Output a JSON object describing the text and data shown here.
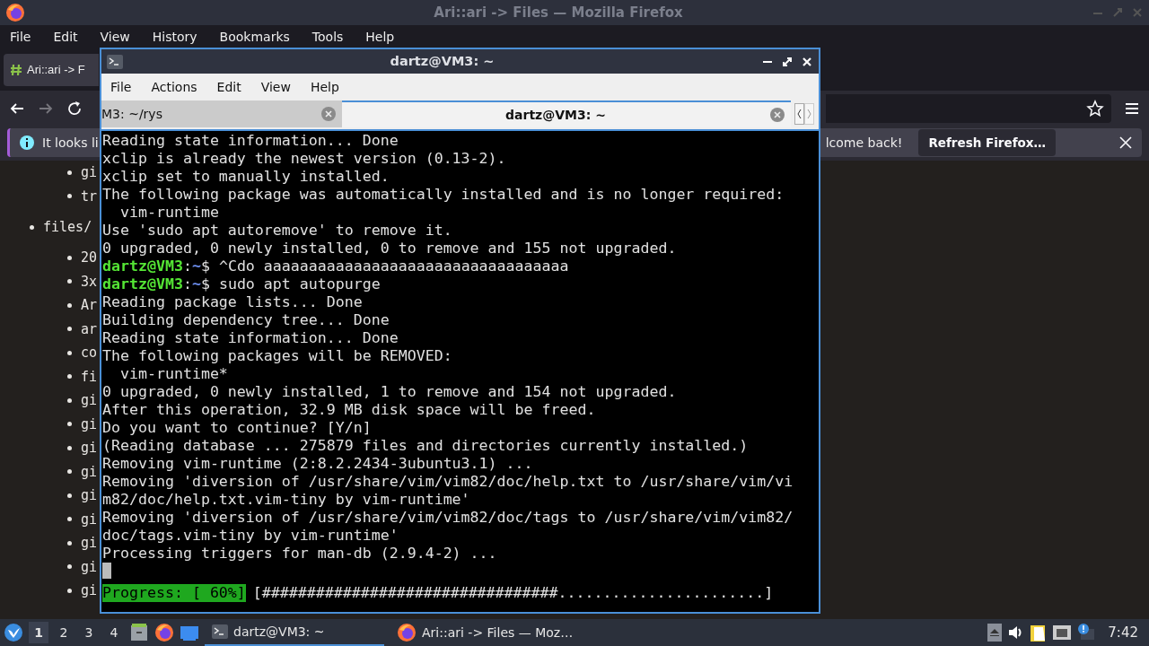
{
  "firefox": {
    "title": "Ari::ari -> Files — Mozilla Firefox",
    "menu": [
      "File",
      "Edit",
      "View",
      "History",
      "Bookmarks",
      "Tools",
      "Help"
    ],
    "tab": {
      "label": "Ari::ari -> F"
    },
    "notification": {
      "message": "It looks li",
      "message_end": "lcome back!",
      "button": "Refresh Firefox…"
    },
    "page_list_top": [
      "gi",
      "tr"
    ],
    "page_list": [
      {
        "label": "files/",
        "children": [
          {
            "label": "20"
          },
          {
            "label": "3x"
          },
          {
            "label": "Ar"
          },
          {
            "label": "ar"
          },
          {
            "label": "co"
          },
          {
            "label": "fi"
          },
          {
            "label": "gi"
          },
          {
            "label": "gi"
          },
          {
            "label": "gi"
          },
          {
            "label": "gi"
          },
          {
            "label": "gi"
          },
          {
            "label": "gi"
          },
          {
            "label": "gi"
          },
          {
            "label": "gi"
          },
          {
            "label": "gi"
          }
        ]
      }
    ]
  },
  "terminal": {
    "title": "dartz@VM3: ~",
    "menu": [
      "File",
      "Actions",
      "Edit",
      "View",
      "Help"
    ],
    "tabs": [
      {
        "label": "M3: ~/rys",
        "selected": false
      },
      {
        "label": "dartz@VM3: ~",
        "selected": true
      }
    ],
    "lines": [
      {
        "kind": "output",
        "text": "Reading state information... Done"
      },
      {
        "kind": "output",
        "text": "xclip is already the newest version (0.13-2)."
      },
      {
        "kind": "output",
        "text": "xclip set to manually installed."
      },
      {
        "kind": "output",
        "text": "The following package was automatically installed and is no longer required:"
      },
      {
        "kind": "output",
        "text": "  vim-runtime"
      },
      {
        "kind": "output",
        "text": "Use 'sudo apt autoremove' to remove it."
      },
      {
        "kind": "output",
        "text": "0 upgraded, 0 newly installed, 0 to remove and 155 not upgraded."
      },
      {
        "kind": "prompt",
        "segments": [
          {
            "kind": "user",
            "text": "dartz@VM3"
          },
          {
            "kind": "plain",
            "text": ":"
          },
          {
            "kind": "path",
            "text": "~"
          },
          {
            "kind": "plain",
            "text": "$ ^Cdo aaaaaaaaaaaaaaaaaaaaaaaaaaaaaaaaaa"
          }
        ]
      },
      {
        "kind": "prompt",
        "segments": [
          {
            "kind": "user",
            "text": "dartz@VM3"
          },
          {
            "kind": "plain",
            "text": ":"
          },
          {
            "kind": "path",
            "text": "~"
          },
          {
            "kind": "plain",
            "text": "$ sudo apt autopurge"
          }
        ]
      },
      {
        "kind": "output",
        "text": "Reading package lists... Done"
      },
      {
        "kind": "output",
        "text": "Building dependency tree... Done"
      },
      {
        "kind": "output",
        "text": "Reading state information... Done"
      },
      {
        "kind": "output",
        "text": "The following packages will be REMOVED:"
      },
      {
        "kind": "output",
        "text": "  vim-runtime*"
      },
      {
        "kind": "output",
        "text": "0 upgraded, 0 newly installed, 1 to remove and 154 not upgraded."
      },
      {
        "kind": "output",
        "text": "After this operation, 32.9 MB disk space will be freed."
      },
      {
        "kind": "output",
        "text": "Do you want to continue? [Y/n]"
      },
      {
        "kind": "output",
        "text": "(Reading database ... 275879 files and directories currently installed.)"
      },
      {
        "kind": "output",
        "text": "Removing vim-runtime (2:8.2.2434-3ubuntu3.1) ..."
      },
      {
        "kind": "output",
        "text": "Removing 'diversion of /usr/share/vim/vim82/doc/help.txt to /usr/share/vim/vi"
      },
      {
        "kind": "output",
        "text": "m82/doc/help.txt.vim-tiny by vim-runtime'"
      },
      {
        "kind": "output",
        "text": "Removing 'diversion of /usr/share/vim/vim82/doc/tags to /usr/share/vim/vim82/"
      },
      {
        "kind": "output",
        "text": "doc/tags.vim-tiny by vim-runtime'"
      },
      {
        "kind": "output",
        "text": "Processing triggers for man-db (2.9.4-2) ..."
      },
      {
        "kind": "cursor"
      },
      {
        "kind": "progress",
        "label": "Progress: [ 60%]",
        "bar": "[#################################.......................]"
      }
    ]
  },
  "taskbar": {
    "workspaces": [
      {
        "label": "1",
        "selected": true
      },
      {
        "label": "2",
        "selected": false
      },
      {
        "label": "3",
        "selected": false
      },
      {
        "label": "4",
        "selected": false
      }
    ],
    "tasks": [
      {
        "kind": "terminal",
        "label": "dartz@VM3: ~",
        "selected": true
      },
      {
        "kind": "browser",
        "label": "Ari::ari -> Files — Moz…",
        "selected": false
      }
    ],
    "clock": "7:42"
  }
}
